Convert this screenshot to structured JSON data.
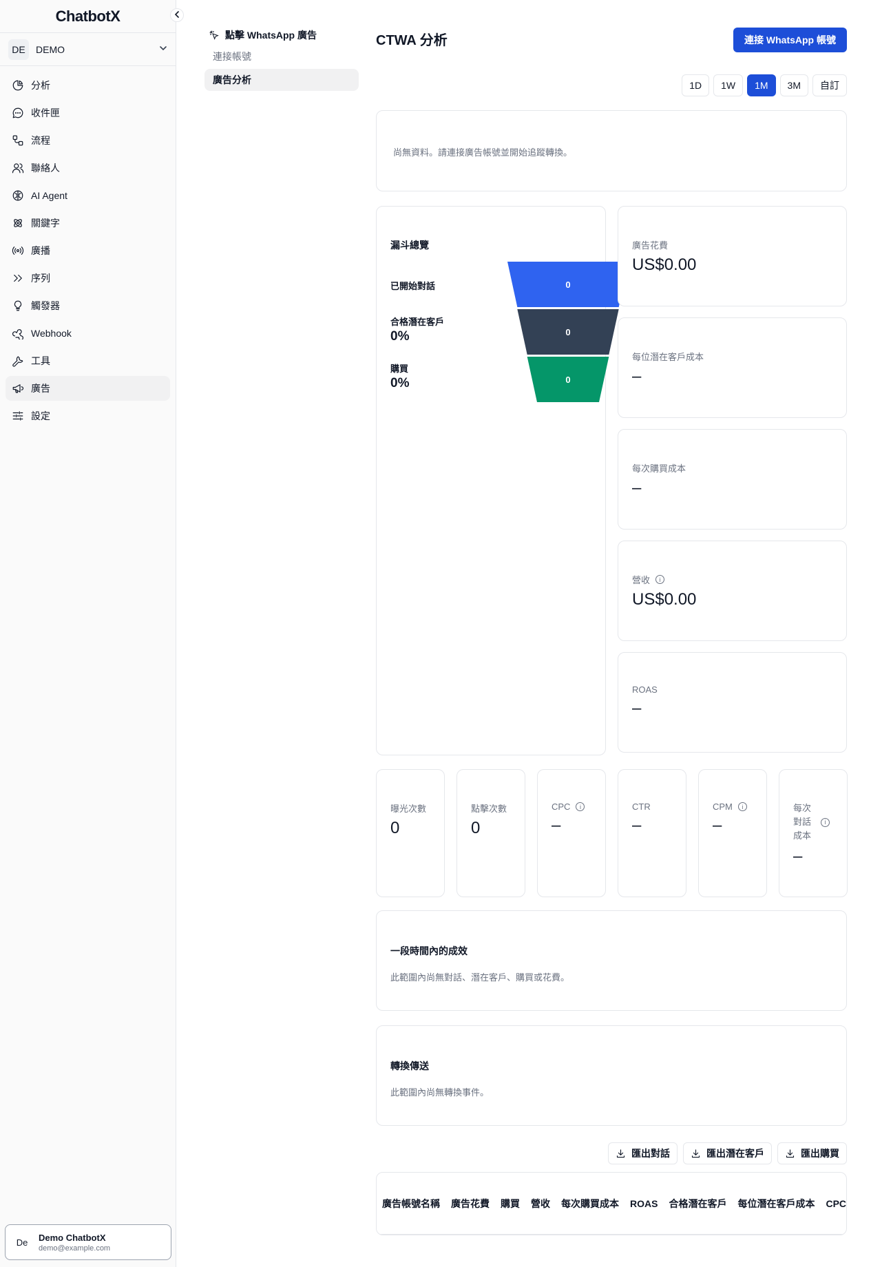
{
  "app": {
    "logo": "ChatbotX"
  },
  "workspace": {
    "initials": "DE",
    "name": "DEMO"
  },
  "sidebar": {
    "items": [
      {
        "label": "分析",
        "icon": "pie-chart-icon"
      },
      {
        "label": "收件匣",
        "icon": "chat-bubble-icon"
      },
      {
        "label": "流程",
        "icon": "flow-icon"
      },
      {
        "label": "聯絡人",
        "icon": "users-icon"
      },
      {
        "label": "AI Agent",
        "icon": "brain-icon"
      },
      {
        "label": "關鍵字",
        "icon": "atom-icon"
      },
      {
        "label": "廣播",
        "icon": "broadcast-icon"
      },
      {
        "label": "序列",
        "icon": "double-chevron-icon"
      },
      {
        "label": "觸發器",
        "icon": "lightbulb-icon"
      },
      {
        "label": "Webhook",
        "icon": "webhook-icon"
      },
      {
        "label": "工具",
        "icon": "wrench-icon"
      },
      {
        "label": "廣告",
        "icon": "megaphone-icon",
        "active": true
      },
      {
        "label": "設定",
        "icon": "sliders-icon"
      }
    ]
  },
  "user": {
    "initials": "De",
    "name": "Demo ChatbotX",
    "email": "demo@example.com"
  },
  "subnav": {
    "title": "點擊 WhatsApp 廣告",
    "items": [
      {
        "label": "連接帳號",
        "active": false
      },
      {
        "label": "廣告分析",
        "active": true
      }
    ]
  },
  "header": {
    "title": "CTWA 分析",
    "connect_label": "連接 WhatsApp 帳號"
  },
  "ranges": [
    "1D",
    "1W",
    "1M",
    "3M",
    "自訂"
  ],
  "active_range": "1M",
  "empty_notice": "尚無資料。請連接廣告帳號並開始追蹤轉換。",
  "funnel": {
    "title": "漏斗總覽",
    "stages": [
      {
        "label": "已開始對話",
        "percent": "",
        "value": "0",
        "color": "#2f63f0"
      },
      {
        "label": "合格潛在客戶",
        "percent": "0%",
        "value": "0",
        "color": "#334155"
      },
      {
        "label": "購買",
        "percent": "0%",
        "value": "0",
        "color": "#059669"
      }
    ]
  },
  "metrics": [
    {
      "label": "廣告花費",
      "value": "US$0.00",
      "info": false
    },
    {
      "label": "每位潛在客戶成本",
      "value": "–",
      "info": false
    },
    {
      "label": "每次購買成本",
      "value": "–",
      "info": false
    },
    {
      "label": "營收",
      "value": "US$0.00",
      "info": true
    },
    {
      "label": "ROAS",
      "value": "–",
      "info": false
    }
  ],
  "small_metrics": [
    {
      "label": "曝光次數",
      "value": "0",
      "info": false
    },
    {
      "label": "點擊次數",
      "value": "0",
      "info": false
    },
    {
      "label": "CPC",
      "value": "–",
      "info": true
    },
    {
      "label": "CTR",
      "value": "–",
      "info": false
    },
    {
      "label": "CPM",
      "value": "–",
      "info": true
    },
    {
      "label": "每次對話成本",
      "value": "–",
      "info": true
    }
  ],
  "performance": {
    "title": "一段時間內的成效",
    "note": "此範圍內尚無對話、潛在客戶、購買或花費。"
  },
  "conversions": {
    "title": "轉換傳送",
    "note": "此範圍內尚無轉換事件。"
  },
  "exports": [
    "匯出對話",
    "匯出潛在客戶",
    "匯出購買"
  ],
  "table": {
    "columns": [
      "廣告帳號名稱",
      "廣告花費",
      "購買",
      "營收",
      "每次購買成本",
      "ROAS",
      "合格潛在客戶",
      "每位潛在客戶成本",
      "CPC"
    ]
  }
}
